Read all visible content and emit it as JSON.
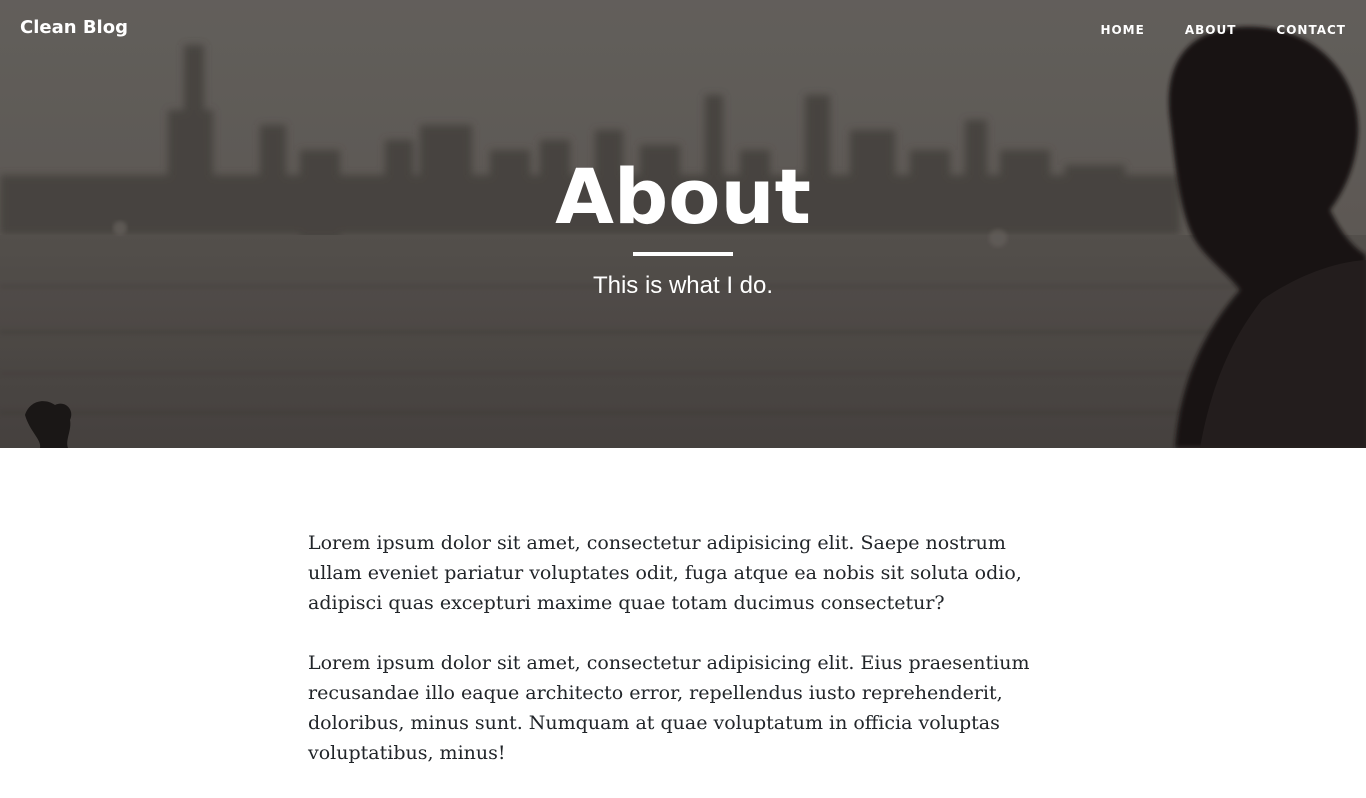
{
  "navbar": {
    "brand": "Clean Blog",
    "links": [
      {
        "label": "HOME"
      },
      {
        "label": "ABOUT"
      },
      {
        "label": "CONTACT"
      }
    ]
  },
  "header": {
    "title": "About",
    "subtitle": "This is what I do."
  },
  "content": {
    "paragraphs": [
      "Lorem ipsum dolor sit amet, consectetur adipisicing elit. Saepe nostrum ullam eveniet pariatur voluptates odit, fuga atque ea nobis sit soluta odio, adipisci quas excepturi maxime quae totam ducimus consectetur?",
      "Lorem ipsum dolor sit amet, consectetur adipisicing elit. Eius praesentium recusandae illo eaque architecto error, repellendus iusto reprehenderit, doloribus, minus sunt. Numquam at quae voluptatum in officia voluptas voluptatibus, minus!"
    ]
  },
  "colors": {
    "header_overlay": "#6e6a66",
    "text_dark": "#212529",
    "white": "#ffffff"
  }
}
